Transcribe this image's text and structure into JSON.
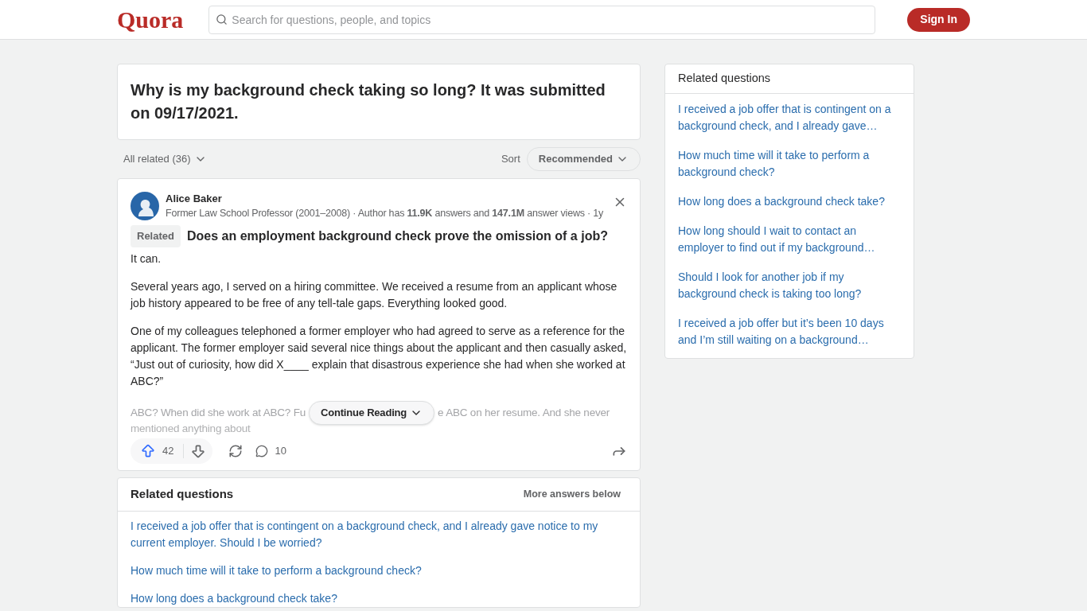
{
  "header": {
    "logo": "Quora",
    "search_placeholder": "Search for questions, people, and topics",
    "sign_in": "Sign In"
  },
  "question": {
    "title": "Why is my background check taking so long? It was submitted on 09/17/2021."
  },
  "filter": {
    "label": "All related (36)",
    "sort_label": "Sort",
    "sort_value": "Recommended"
  },
  "answer": {
    "author": "Alice Baker",
    "credentials": "Former Law School Professor (2001–2008) · Author has **11.9K** answers and **147.1M** answer views · 1y",
    "badge": "Related",
    "related_question": "Does an employment background check prove the omission of a job?",
    "paragraphs": [
      "It can.",
      "Several years ago, I served on a hiring committee. We received a resume from an applicant whose job history appeared to be free of any tell-tale gaps. Everything looked good.",
      "One of my colleagues telephoned a former employer who had agreed to serve as a reference for the applicant. The former employer said several nice things about the applicant and then casually asked, “Just out of curiosity, how did X____ explain that disastrous experience she had when she worked at ABC?”"
    ],
    "faded_left": "ABC? When did she work at ABC? Fu",
    "faded_right": "e ABC on her resume. And she never",
    "faded_line2": "mentioned anything about",
    "continue": "Continue Reading",
    "upvotes": "42",
    "comments": "10"
  },
  "related_bottom": {
    "title": "Related questions",
    "more": "More answers below",
    "items": [
      "I received a job offer that is contingent on a background check, and I already gave notice to my current employer. Should I be worried?",
      "How much time will it take to perform a background check?",
      "How long does a background check take?"
    ]
  },
  "sidebar": {
    "title": "Related questions",
    "items": [
      "I received a job offer that is contingent on a background check, and I already gave…",
      "How much time will it take to perform a background check?",
      "How long does a background check take?",
      "How long should I wait to contact an employer to find out if my background…",
      "Should I look for another job if my background check is taking too long?",
      "I received a job offer but it’s been 10 days and I’m still waiting on a background…"
    ]
  }
}
